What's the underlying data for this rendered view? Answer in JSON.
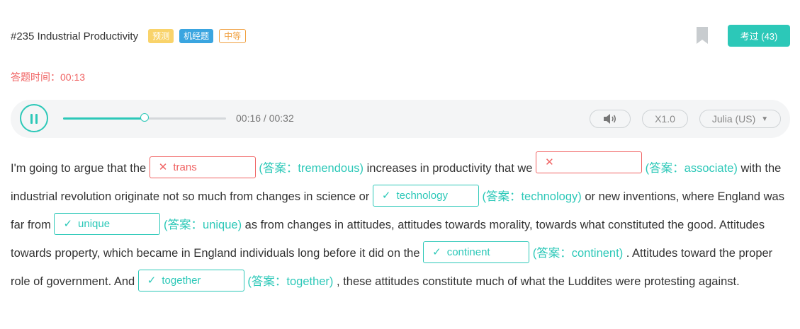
{
  "header": {
    "title": "#235 Industrial Productivity",
    "badges": [
      "预测",
      "机经题",
      "中等"
    ],
    "pass_button": "考过 (43)"
  },
  "timer": "答题时间：00:13",
  "player": {
    "progress": 0.5,
    "time": "00:16 / 00:32",
    "speed": "X1.0",
    "voice": "Julia (US)"
  },
  "passage": {
    "p1": "I'm going to argue that the",
    "b1": {
      "input": "trans",
      "answer": "(答案：tremendous)",
      "mark": "✕"
    },
    "p2": "increases in productivity that we",
    "b2": {
      "input": "",
      "answer": "(答案：associate)",
      "mark": "✕"
    },
    "p3": "with the industrial revolution originate not so much from changes in science or",
    "b3": {
      "input": "technology",
      "answer": "(答案：technology)",
      "mark": "✓"
    },
    "p4": "or new inventions, where England was far from",
    "b4": {
      "input": "unique",
      "answer": "(答案：unique)",
      "mark": "✓"
    },
    "p5": "as from changes in attitudes, attitudes towards morality, towards what constituted the good. Attitudes towards property, which became in England individuals long before it did on the",
    "b5": {
      "input": "continent",
      "answer": "(答案：continent)",
      "mark": "✓"
    },
    "p6": ". Attitudes toward the proper role of government. And",
    "b6": {
      "input": "together",
      "answer": "(答案：together)",
      "mark": "✓"
    },
    "p7": ", these attitudes constitute much of what the Luddites were protesting against."
  },
  "colors": {
    "accent": "#2cc8b8",
    "error": "#f06262",
    "badge_yellow": "#f9d36a",
    "badge_blue": "#3aa5e0",
    "badge_orange": "#f0a040"
  },
  "icons": [
    "bookmark-icon",
    "pause-icon",
    "volume-icon",
    "caret-down-icon",
    "cross-icon",
    "check-icon"
  ]
}
